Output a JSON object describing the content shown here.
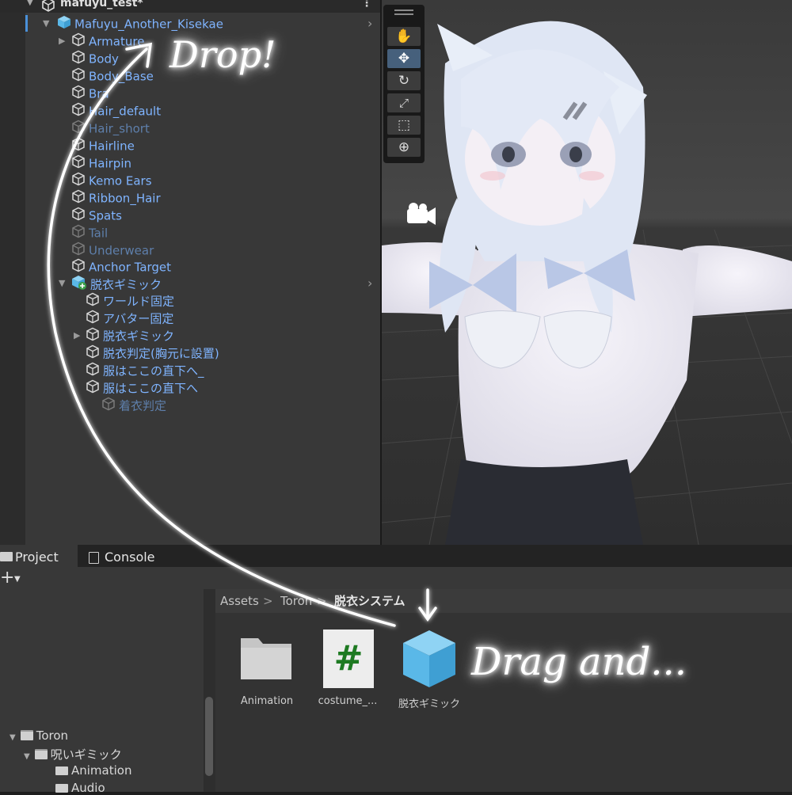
{
  "hierarchy": {
    "scene_name": "mafuyu_test*",
    "items": [
      {
        "label": "Mafuyu_Another_Kisekae"
      },
      {
        "label": "Armature"
      },
      {
        "label": "Body"
      },
      {
        "label": "Body_Base"
      },
      {
        "label": "Bra"
      },
      {
        "label": "Hair_default"
      },
      {
        "label": "Hair_short"
      },
      {
        "label": "Hairline"
      },
      {
        "label": "Hairpin"
      },
      {
        "label": "Kemo Ears"
      },
      {
        "label": "Ribbon_Hair"
      },
      {
        "label": "Spats"
      },
      {
        "label": "Tail"
      },
      {
        "label": "Underwear"
      },
      {
        "label": "Anchor Target"
      },
      {
        "label": "脱衣ギミック"
      },
      {
        "label": "ワールド固定"
      },
      {
        "label": "アバター固定"
      },
      {
        "label": "脱衣ギミック"
      },
      {
        "label": "脱衣判定(胸元に設置)"
      },
      {
        "label": "服はここの直下へ_"
      },
      {
        "label": "服はここの直下へ"
      },
      {
        "label": "着衣判定"
      }
    ]
  },
  "scene_tools": [
    "hand-tool",
    "move-tool",
    "rotate-tool",
    "scale-tool",
    "rect-tool",
    "transform-tool"
  ],
  "bottom": {
    "tabs": [
      {
        "label": "Project"
      },
      {
        "label": "Console"
      }
    ],
    "add_label": "+",
    "breadcrumb": [
      "Assets",
      ">",
      "Toron",
      ">",
      "脱衣システム"
    ],
    "assets": [
      {
        "label": "Animation",
        "icon": "folder-icon"
      },
      {
        "label": "costume_...",
        "icon": "csharp-script-icon",
        "glyph": "#"
      },
      {
        "label": "脱衣ギミック",
        "icon": "prefab-icon"
      }
    ],
    "tree": [
      {
        "label": "Toron"
      },
      {
        "label": "呪いギミック"
      },
      {
        "label": "Animation"
      },
      {
        "label": "Audio"
      }
    ]
  },
  "annotations": {
    "drop": "Drop!",
    "drag": "Drag and..."
  },
  "colors": {
    "prefab": "#7fb4ff",
    "accent_blue": "#5ab8e8",
    "panel": "#383838"
  }
}
